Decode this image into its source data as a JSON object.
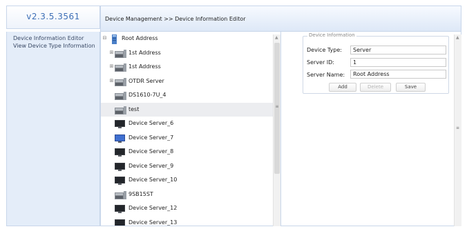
{
  "header": {
    "version": "v2.3.5.3561",
    "breadcrumb": "Device Management >> Device Information Editor"
  },
  "sidebar": {
    "items": [
      {
        "label": "Device Information Editor"
      },
      {
        "label": "View Device Type Information"
      }
    ]
  },
  "tree": {
    "nodes": [
      {
        "label": "Root Address",
        "icon": "server-tower-icon",
        "expander": "minus"
      },
      {
        "label": "1st Address",
        "icon": "device-rack-icon",
        "expander": "plus"
      },
      {
        "label": "1st Address",
        "icon": "device-rack-icon",
        "expander": "plus"
      },
      {
        "label": "OTDR Server",
        "icon": "device-rack-icon",
        "expander": "plus"
      },
      {
        "label": "DS1610-7U_4",
        "icon": "device-rack-icon",
        "expander": ""
      },
      {
        "label": "test",
        "icon": "device-rack-icon",
        "expander": ""
      },
      {
        "label": "Device Server_6",
        "icon": "device-monitor-icon",
        "expander": ""
      },
      {
        "label": "Device Server_7",
        "icon": "device-monitor-blue-icon",
        "expander": ""
      },
      {
        "label": "Device Server_8",
        "icon": "device-monitor-icon",
        "expander": ""
      },
      {
        "label": "Device Server_9",
        "icon": "device-monitor-icon",
        "expander": ""
      },
      {
        "label": "Device Server_10",
        "icon": "device-monitor-icon",
        "expander": ""
      },
      {
        "label": "9SB15ST",
        "icon": "device-rack-icon",
        "expander": ""
      },
      {
        "label": "Device Server_12",
        "icon": "device-monitor-icon",
        "expander": ""
      },
      {
        "label": "Device Server_13",
        "icon": "device-monitor-icon",
        "expander": ""
      }
    ],
    "selected_label": "test"
  },
  "form": {
    "legend": "Device Information",
    "device_type_label": "Device Type:",
    "device_type_value": "Server",
    "server_id_label": "Server ID:",
    "server_id_value": "1",
    "server_name_label": "Server Name:",
    "server_name_value": "Root Address",
    "add_label": "Add",
    "delete_label": "Delete",
    "save_label": "Save"
  },
  "colors": {
    "accent": "#3d6fb6",
    "sidebar_bg": "#e4edf9",
    "border": "#c8d6ea"
  }
}
